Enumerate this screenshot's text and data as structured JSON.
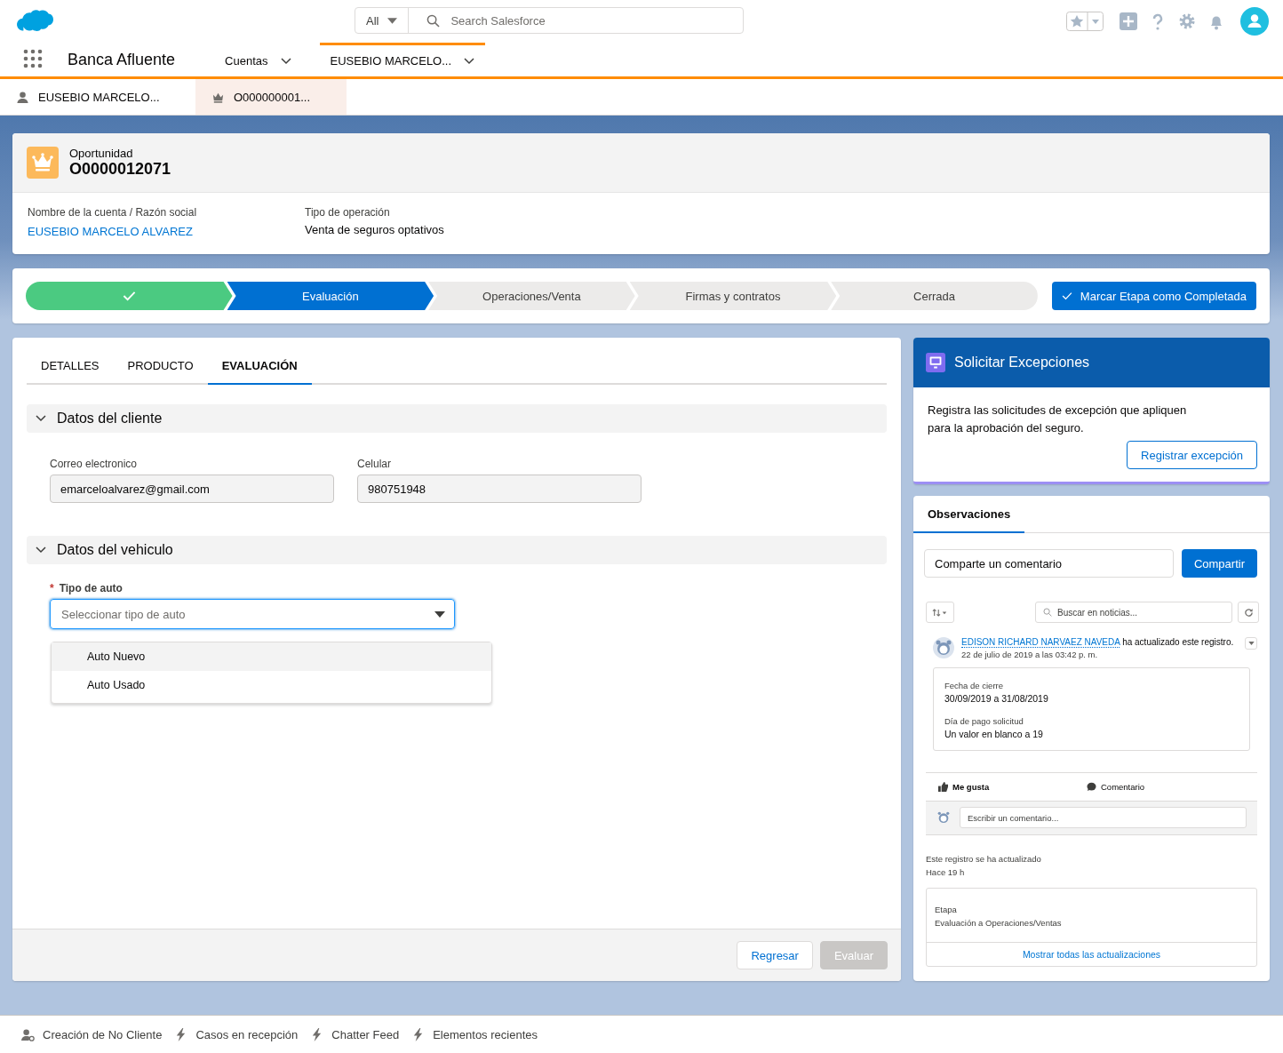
{
  "header": {
    "search_scope": "All",
    "search_placeholder": "Search Salesforce"
  },
  "app_name": "Banca Afluente",
  "nav_items": [
    {
      "label": "Cuentas",
      "selected": false
    },
    {
      "label": "EUSEBIO MARCELO...",
      "selected": true
    }
  ],
  "workspace_tabs": [
    {
      "label": "EUSEBIO MARCELO...",
      "kind": "person",
      "selected": false
    },
    {
      "label": "O000000001...",
      "kind": "opportunity",
      "selected": true
    }
  ],
  "record": {
    "object_type": "Oportunidad",
    "title": "O0000012071",
    "fields": [
      {
        "label": "Nombre de la cuenta / Razón social",
        "value": "EUSEBIO MARCELO ALVAREZ",
        "kind": "link"
      },
      {
        "label": "Tipo de operación",
        "value": "Venta de seguros optativos",
        "kind": "text"
      }
    ]
  },
  "path": {
    "stages": [
      {
        "complete": true,
        "selected": false
      },
      {
        "label": "Evaluación",
        "complete": false,
        "selected": true
      },
      {
        "label": "Operaciones/Venta",
        "complete": false,
        "selected": false
      },
      {
        "label": "Firmas y contratos",
        "complete": false,
        "selected": false
      },
      {
        "label": "Cerrada",
        "complete": false,
        "selected": false
      }
    ],
    "button": "Marcar Etapa como Completada"
  },
  "tabs": [
    {
      "label": "DETALLES",
      "selected": false
    },
    {
      "label": "PRODUCTO",
      "selected": false
    },
    {
      "label": "EVALUACIÓN",
      "selected": true
    }
  ],
  "client_section": {
    "title": "Datos del cliente",
    "expanded": true,
    "fields": [
      {
        "label": "Correo electronico",
        "value": "emarceloalvarez@gmail.com"
      },
      {
        "label": "Celular",
        "value": "980751948"
      }
    ]
  },
  "vehicle_section": {
    "title": "Datos del vehiculo",
    "expanded": true,
    "picklist": {
      "label": "Tipo de auto",
      "required_mark": "*",
      "placeholder": "Seleccionar tipo de auto",
      "open": true,
      "options": [
        {
          "label": "Auto Nuevo",
          "highlighted": true
        },
        {
          "label": "Auto Usado",
          "highlighted": false
        }
      ]
    }
  },
  "footer_buttons": [
    {
      "label": "Regresar",
      "disabled": false
    },
    {
      "label": "Evaluar",
      "disabled": true
    }
  ],
  "exceptions": {
    "title": "Solicitar Excepciones",
    "text": "Registra las solicitudes de excepción que apliquen para la aprobación del seguro.",
    "button": "Registrar excepción"
  },
  "observations": {
    "tab": "Observaciones",
    "comment_placeholder": "Comparte un comentario",
    "share_button": "Compartir",
    "search_placeholder": "Buscar en noticias...",
    "post": {
      "author": "EDISON RICHARD NARVAEZ NAVEDA",
      "action": "ha actualizado este registro.",
      "time": "22 de julio de 2019 a las 03:42 p. m.",
      "changes": [
        {
          "label": "Fecha de cierre",
          "value": "30/09/2019 a 31/08/2019"
        },
        {
          "label": "Día de pago solicitud",
          "value": "Un valor en blanco a 19"
        }
      ],
      "like": "Me gusta",
      "comment": "Comentario",
      "reply_placeholder": "Escribir un comentario..."
    },
    "update": {
      "text": "Este registro se ha actualizado",
      "time": "Hace 19 h",
      "field": "Etapa",
      "value": "Evaluación a Operaciones/Ventas",
      "link": "Mostrar todas las actualizaciones"
    }
  },
  "utility_bar": [
    {
      "label": "Creación de No Cliente",
      "kind": "person"
    },
    {
      "label": "Casos en recepción",
      "kind": "bolt"
    },
    {
      "label": "Chatter Feed",
      "kind": "bolt"
    },
    {
      "label": "Elementos recientes",
      "kind": "bolt"
    }
  ]
}
